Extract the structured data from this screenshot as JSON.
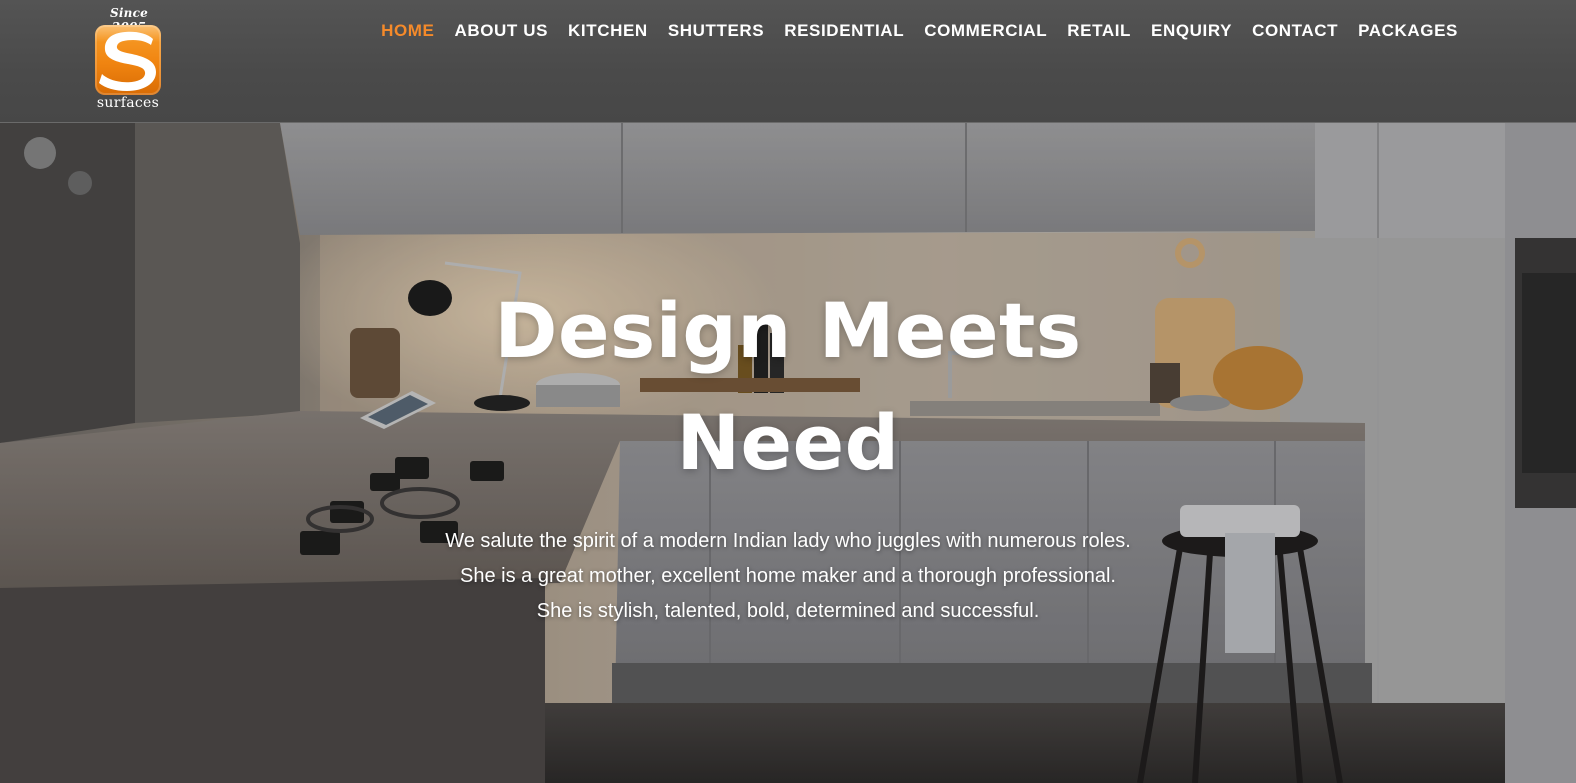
{
  "brand": {
    "tagline": "Since 2005",
    "logo_letter": "S",
    "name": "surfaces",
    "accent_color": "#f08410"
  },
  "nav": {
    "active_color": "#f58a2a",
    "items": [
      {
        "label": "HOME",
        "active": true
      },
      {
        "label": "ABOUT US",
        "active": false
      },
      {
        "label": "KITCHEN",
        "active": false
      },
      {
        "label": "SHUTTERS",
        "active": false
      },
      {
        "label": "RESIDENTIAL",
        "active": false
      },
      {
        "label": "COMMERCIAL",
        "active": false
      },
      {
        "label": "RETAIL",
        "active": false
      },
      {
        "label": "ENQUIRY",
        "active": false
      },
      {
        "label": "CONTACT",
        "active": false
      },
      {
        "label": "PACKAGES",
        "active": false
      }
    ]
  },
  "hero": {
    "title_line1": "Design Meets",
    "title_line2": "Need",
    "text_line1": "We salute the spirit of a modern Indian lady who juggles with numerous roles.",
    "text_line2": "She is a great mother, excellent home maker and a thorough professional.",
    "text_line3": "She is stylish, talented, bold, determined and successful."
  }
}
